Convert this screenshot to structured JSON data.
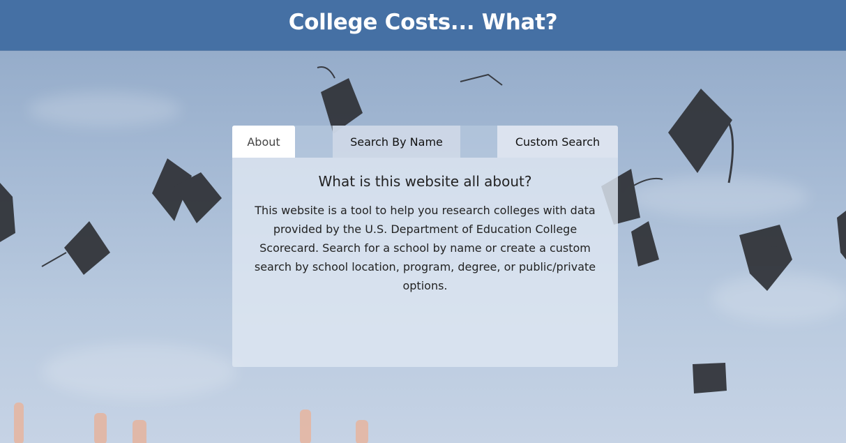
{
  "header": {
    "title": "College Costs... What?"
  },
  "tabs": [
    {
      "label": "About",
      "active": true
    },
    {
      "label": "Search By Name",
      "active": false
    },
    {
      "label": "Custom Search",
      "active": false
    }
  ],
  "about": {
    "heading": "What is this website all about?",
    "body": "This website is a tool to help you research colleges with data provided by the U.S. Department of Education College Scorecard. Search for a school by name or create a custom search by school location, program, degree, or public/private options."
  },
  "colors": {
    "header_bg": "#4570a4",
    "header_text": "#ffffff",
    "active_tab_bg": "#ffffff",
    "panel_bg": "#dee6f1"
  },
  "background": {
    "icon": "graduation-caps-in-sky"
  }
}
